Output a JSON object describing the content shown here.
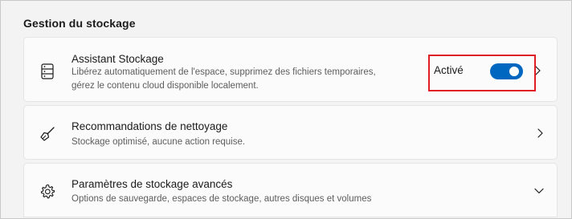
{
  "section": {
    "title": "Gestion du stockage"
  },
  "cards": [
    {
      "icon": "storage-drive-icon",
      "title": "Assistant Stockage",
      "description_line1": "Libérez automatiquement de l'espace, supprimez des fichiers temporaires,",
      "description_line2": "gérez le contenu cloud disponible localement.",
      "toggle_label": "Activé",
      "toggle_on": true,
      "chevron": "chevron-right-icon"
    },
    {
      "icon": "broom-icon",
      "title": "Recommandations de nettoyage",
      "description": "Stockage optimisé, aucune action requise.",
      "chevron": "chevron-right-icon"
    },
    {
      "icon": "gear-icon",
      "title": "Paramètres de stockage avancés",
      "description": "Options de sauvegarde, espaces de stockage, autres disques et volumes",
      "chevron": "chevron-down-icon"
    }
  ],
  "colors": {
    "accent": "#0067c0",
    "highlight_border": "#e01c24",
    "background": "#f3f3f3",
    "card": "#fbfbfb"
  }
}
